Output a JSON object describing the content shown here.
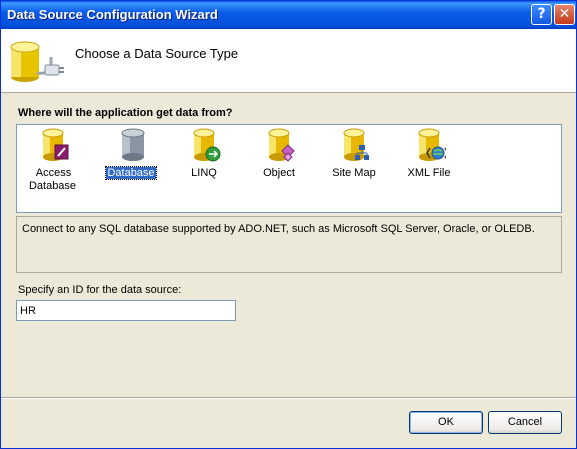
{
  "window": {
    "title": "Data Source Configuration Wizard"
  },
  "titlebar_buttons": {
    "help": "?",
    "close": "✕"
  },
  "header": {
    "heading": "Choose a Data Source Type"
  },
  "question": "Where will the application get data from?",
  "types": [
    {
      "label": "Access Database",
      "icon": "access-database-icon",
      "selected": false
    },
    {
      "label": "Database",
      "icon": "database-icon",
      "selected": true
    },
    {
      "label": "LINQ",
      "icon": "linq-icon",
      "selected": false
    },
    {
      "label": "Object",
      "icon": "object-icon",
      "selected": false
    },
    {
      "label": "Site Map",
      "icon": "site-map-icon",
      "selected": false
    },
    {
      "label": "XML File",
      "icon": "xml-file-icon",
      "selected": false
    }
  ],
  "description": "Connect to any SQL database supported by ADO.NET, such as Microsoft SQL Server, Oracle, or OLEDB.",
  "id_field": {
    "label": "Specify an ID for the data source:",
    "value": "HR"
  },
  "buttons": {
    "ok": "OK",
    "cancel": "Cancel"
  },
  "colors": {
    "titlebar": "#0a5de8",
    "selection": "#316ac5",
    "dialog_bg": "#ece9d8"
  }
}
